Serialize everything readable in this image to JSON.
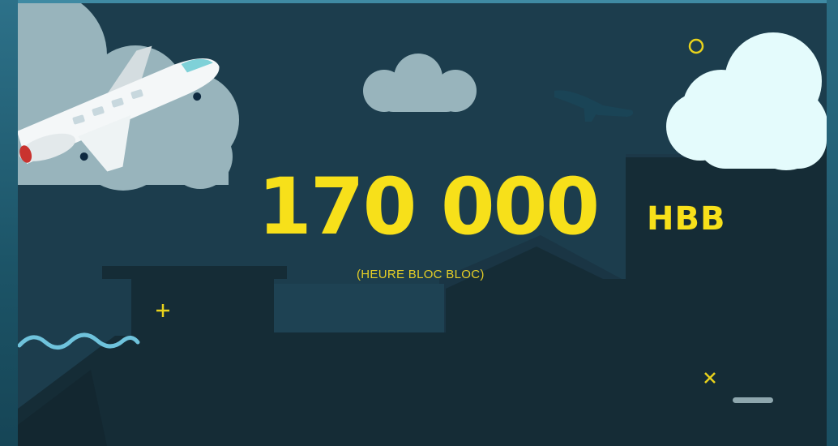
{
  "figure": {
    "value": "170 000",
    "unit": "HBB",
    "subtitle": "(HEURE BLOC BLOC)"
  },
  "colors": {
    "background": "#1c3d4d",
    "accent_yellow": "#f7e01a",
    "cloud_grey": "#98b4bc",
    "cloud_light": "#e4fbfc",
    "wave_blue": "#6fc3dc",
    "building_dark": "#142a33"
  },
  "icons": {
    "airplane": "airplane-icon",
    "small_plane": "plane-silhouette-icon",
    "circle": "circle-icon",
    "plus": "plus-icon",
    "cross": "cross-icon",
    "wave": "wave-icon",
    "dash": "dash-icon"
  }
}
